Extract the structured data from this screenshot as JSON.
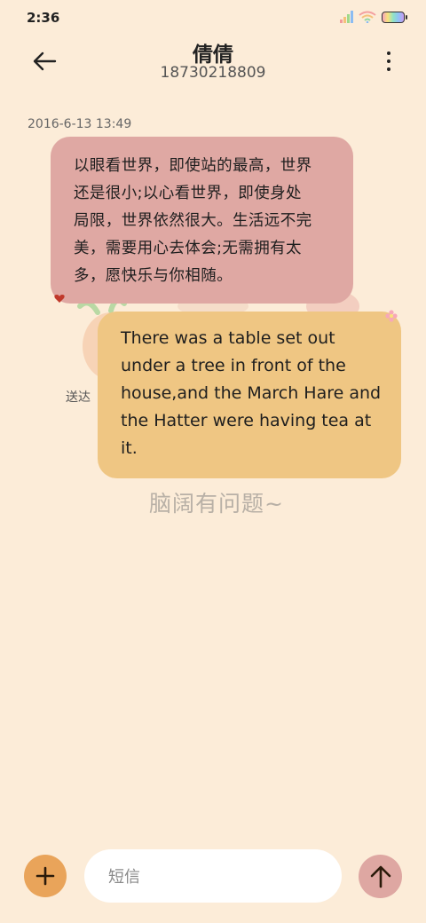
{
  "status_bar": {
    "time": "2:36",
    "icons": [
      "signal-icon",
      "wifi-icon",
      "battery-icon"
    ]
  },
  "header": {
    "contact_name": "倩倩",
    "contact_number": "18730218809",
    "back_icon": "back-arrow-icon",
    "more_icon": "more-vertical-icon"
  },
  "conversation": {
    "timestamp": "2016-6-13 13:49",
    "received_message": {
      "lines": [
        "以眼看世界，即使站的最高，世界",
        "还是很小;以心看世界，即使身处",
        "局限，世界依然很大。生活远不完",
        "美，需要用心去体会;无需拥有太",
        "多，愿快乐与你相随。"
      ],
      "bubble_color": "#dfa8a3"
    },
    "sent_message": {
      "lines": [
        "There was a table set out",
        "under a tree in front of the",
        "house,and the March Hare and",
        "the Hatter were having tea at",
        "it."
      ],
      "status": "送达",
      "bubble_color": "#efc683"
    },
    "watermark": "脑阔有问题~"
  },
  "composer": {
    "placeholder": "短信",
    "add_icon": "plus-icon",
    "send_icon": "send-arrow-icon",
    "add_color": "#e9a45a",
    "send_color": "#dea7a2"
  },
  "theme": {
    "background": "#fcecd8"
  }
}
